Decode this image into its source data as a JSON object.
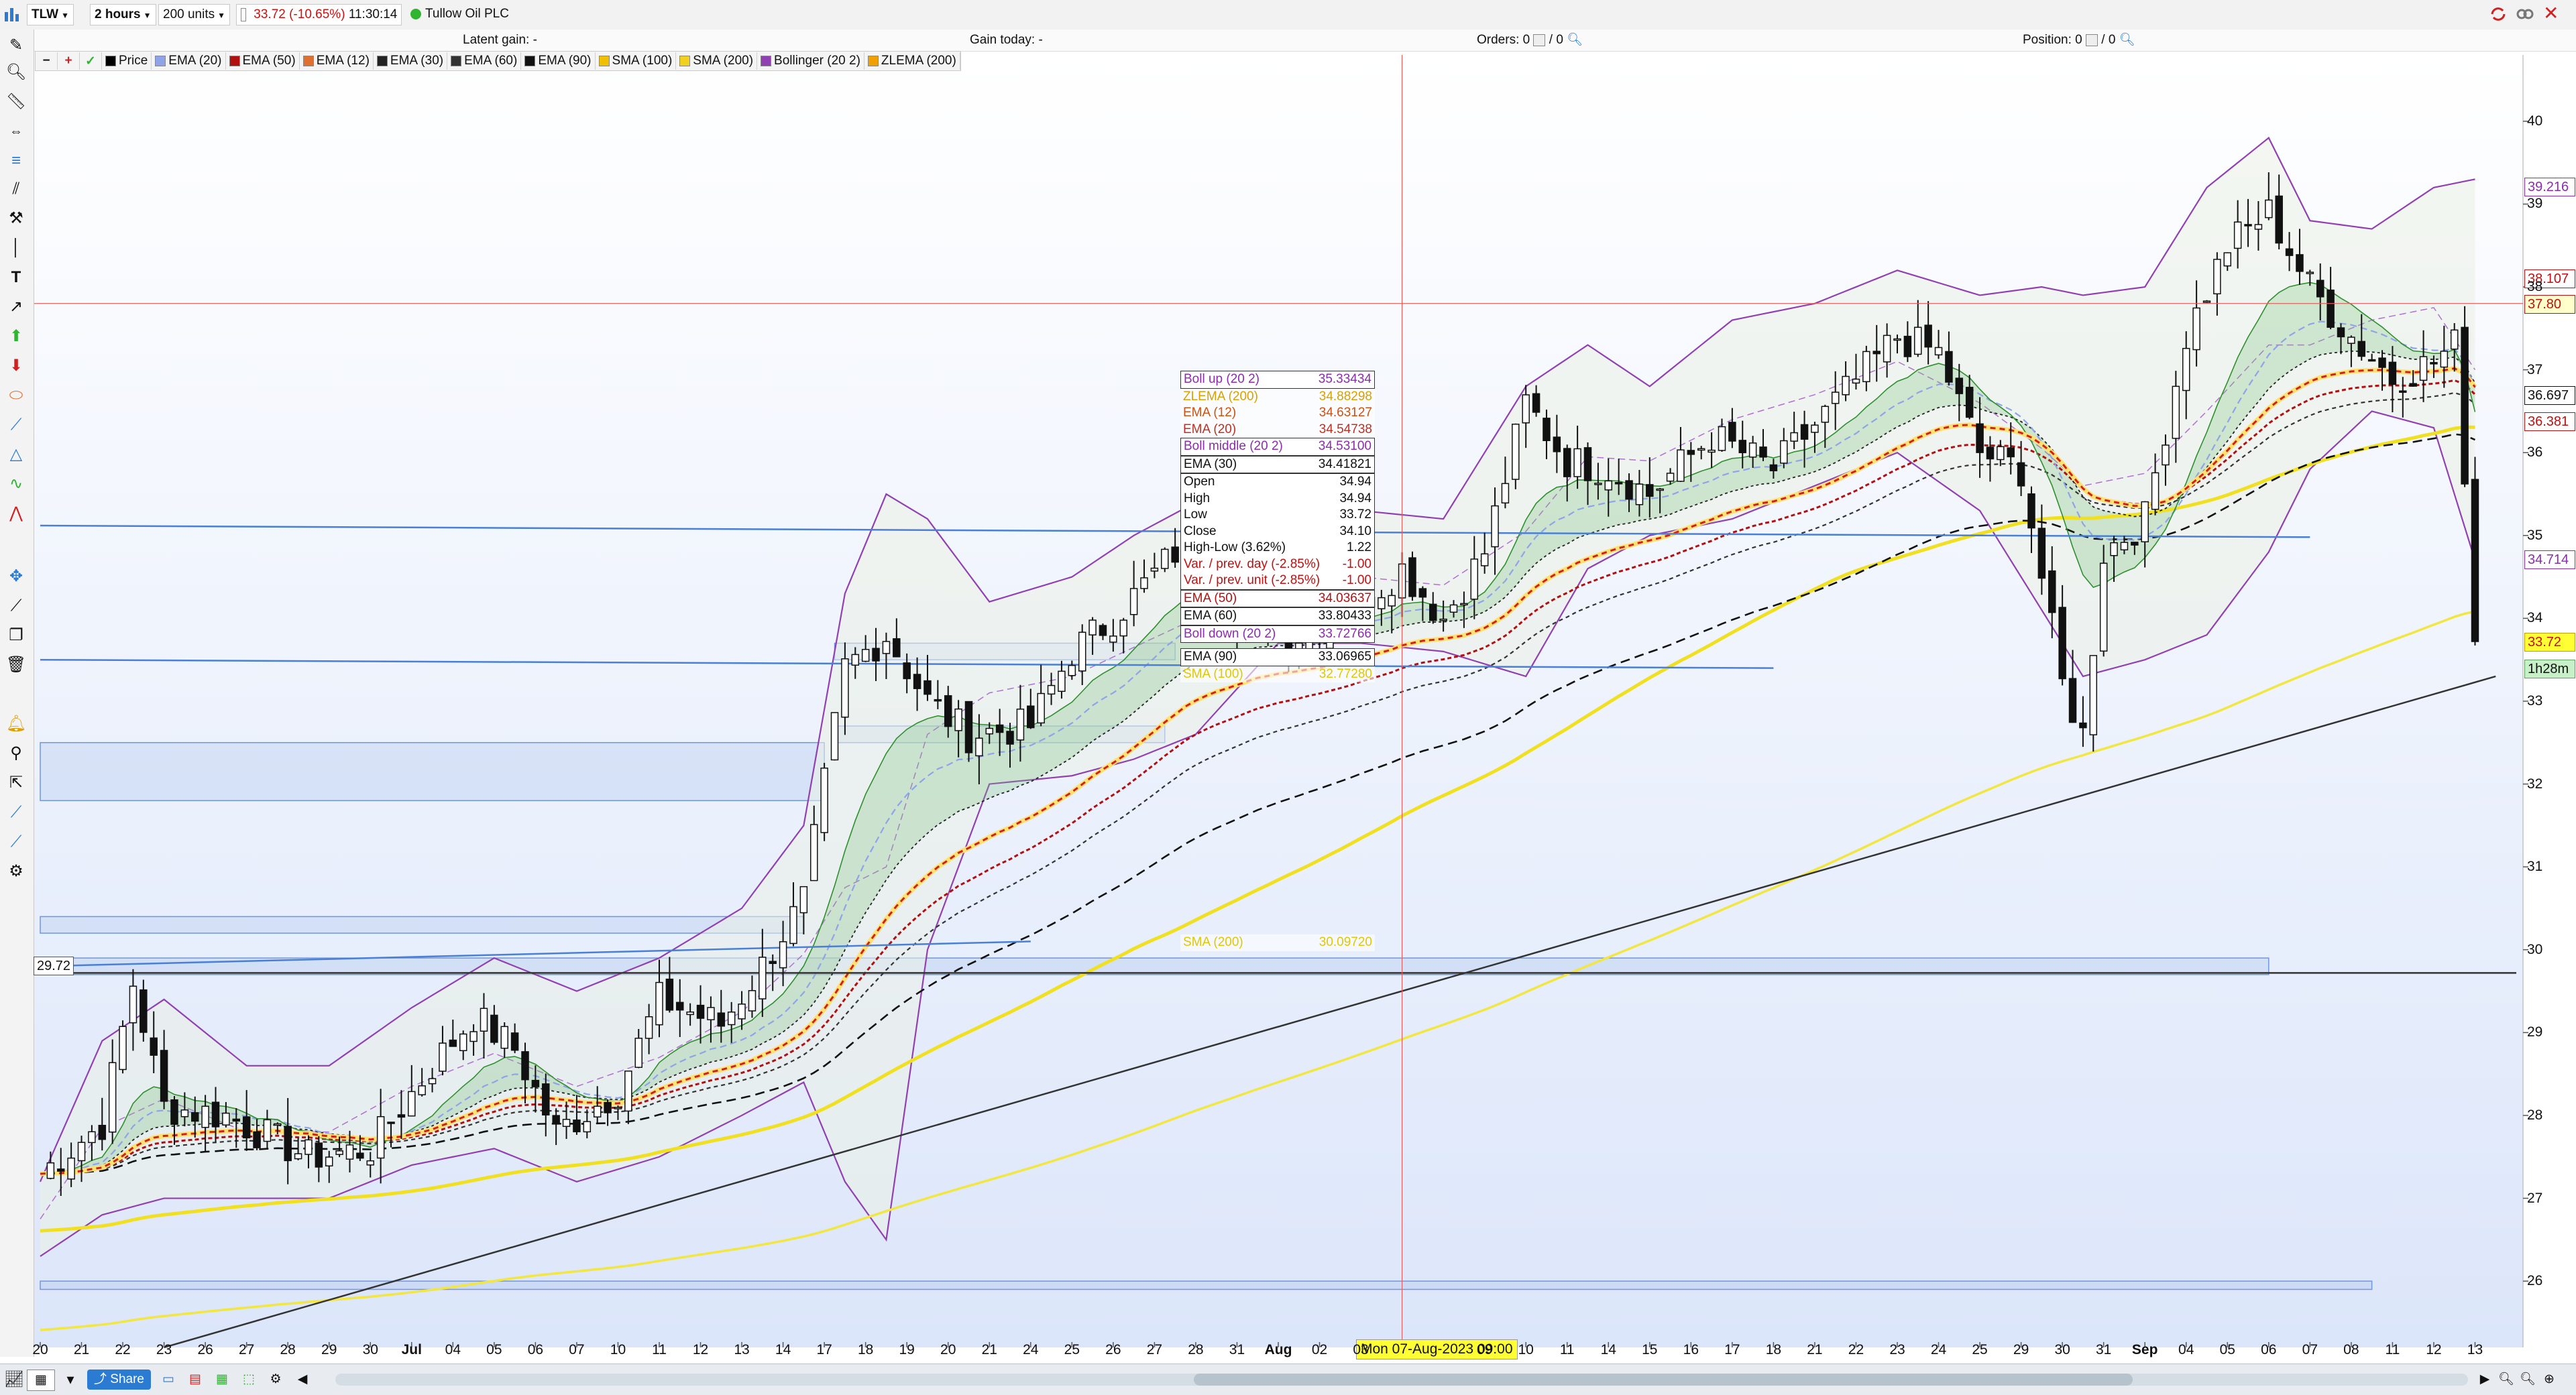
{
  "toolbar": {
    "symbol": "TLW",
    "interval": "2 hours",
    "units": "200 units",
    "last_price": "33.72",
    "change_pct": "(-10.65%)",
    "time": "11:30:14",
    "company": "Tullow Oil PLC"
  },
  "status": {
    "latent_gain": "Latent gain: -",
    "gain_today": "Gain today: -",
    "orders_label": "Orders: 0",
    "orders_count": "0",
    "position_label": "Position: 0",
    "position_count": "0"
  },
  "legend": {
    "items": [
      {
        "label": "Price",
        "color": "#000000"
      },
      {
        "label": "EMA (20)",
        "color": "#8fa3e8"
      },
      {
        "label": "EMA (50)",
        "color": "#b01010"
      },
      {
        "label": "EMA (12)",
        "color": "#e07030"
      },
      {
        "label": "EMA (30)",
        "color": "#222222"
      },
      {
        "label": "EMA (60)",
        "color": "#333333"
      },
      {
        "label": "EMA (90)",
        "color": "#111111"
      },
      {
        "label": "SMA (100)",
        "color": "#f0c000"
      },
      {
        "label": "SMA (200)",
        "color": "#f2d020"
      },
      {
        "label": "Bollinger (20 2)",
        "color": "#9040b0"
      },
      {
        "label": "ZLEMA (200)",
        "color": "#f0a000"
      }
    ]
  },
  "tooltip": {
    "rows_top": [
      {
        "label": "Boll up (20 2)",
        "value": "35.33434",
        "color": "#8b2bb0",
        "boxed": true
      },
      {
        "label": "ZLEMA (200)",
        "value": "34.88298",
        "color": "#d8a000",
        "boxed": false
      },
      {
        "label": "EMA (12)",
        "value": "34.63127",
        "color": "#d05010",
        "boxed": false
      },
      {
        "label": "EMA (20)",
        "value": "34.54738",
        "color": "#c03020",
        "boxed": false
      },
      {
        "label": "Boll middle (20 2)",
        "value": "34.53100",
        "color": "#8b2bb0",
        "boxed": true
      },
      {
        "label": "EMA (30)",
        "value": "34.41821",
        "color": "#111111",
        "boxed": true
      }
    ],
    "ohlc": [
      {
        "label": "Open",
        "value": "34.94"
      },
      {
        "label": "High",
        "value": "34.94"
      },
      {
        "label": "Low",
        "value": "33.72"
      },
      {
        "label": "Close",
        "value": "34.10"
      },
      {
        "label": "High-Low (3.62%)",
        "value": "1.22"
      }
    ],
    "var_rows": [
      {
        "label": "Var. / prev. day (-2.85%)",
        "value": "-1.00"
      },
      {
        "label": "Var. / prev. unit (-2.85%)",
        "value": "-1.00"
      }
    ],
    "rows_bottom": [
      {
        "label": "EMA (50)",
        "value": "34.03637",
        "color": "#b01010",
        "boxed": true
      },
      {
        "label": "EMA (60)",
        "value": "33.80433",
        "color": "#111111",
        "boxed": true
      },
      {
        "label": "Boll down (20 2)",
        "value": "33.72766",
        "color": "#8b2bb0",
        "boxed": true
      },
      {
        "label": "EMA (90)",
        "value": "33.06965",
        "color": "#111111",
        "boxed": true
      },
      {
        "label": "SMA (100)",
        "value": "32.77280",
        "color": "#e0c800",
        "boxed": false
      }
    ],
    "sma200": {
      "label": "SMA (200)",
      "value": "30.09720",
      "color": "#e0c800"
    }
  },
  "crosshair": {
    "datetime": "Mon 07-Aug-2023 09:00",
    "left_price": "29.72"
  },
  "price_labels": [
    {
      "value": "39.216",
      "price": 39.216,
      "bg": "#ffffff",
      "color": "#8b2bb0",
      "border": "#8b2bb0"
    },
    {
      "value": "38.107",
      "price": 38.107,
      "bg": "#ffffff",
      "color": "#c01010",
      "border": "#c01010"
    },
    {
      "value": "37.80",
      "price": 37.8,
      "bg": "#ffffcc",
      "color": "#c01010",
      "border": "#c01010"
    },
    {
      "value": "36.697",
      "price": 36.697,
      "bg": "#ffffff",
      "color": "#111111",
      "border": "#111111"
    },
    {
      "value": "36.381",
      "price": 36.381,
      "bg": "#ffffff",
      "color": "#c01010",
      "border": "#c01010"
    },
    {
      "value": "34.714",
      "price": 34.714,
      "bg": "#ffffff",
      "color": "#8b2bb0",
      "border": "#8b2bb0"
    },
    {
      "value": "33.72",
      "price": 33.72,
      "bg": "#ffff33",
      "color": "#c01010",
      "border": "#c0a000"
    },
    {
      "value": "1h28m",
      "price": 33.4,
      "bg": "#c8f0c8",
      "color": "#111111",
      "border": "#60a060"
    }
  ],
  "chart_data": {
    "type": "candlestick",
    "title": "TLW",
    "ylim": [
      25.2,
      40.8
    ],
    "yticks": [
      26,
      27,
      28,
      29,
      30,
      31,
      32,
      33,
      34,
      35,
      36,
      37,
      38,
      39,
      40
    ],
    "xticks": [
      {
        "label": "20",
        "i": 0
      },
      {
        "label": "21",
        "i": 4
      },
      {
        "label": "22",
        "i": 8
      },
      {
        "label": "23",
        "i": 12
      },
      {
        "label": "26",
        "i": 16
      },
      {
        "label": "27",
        "i": 20
      },
      {
        "label": "28",
        "i": 24
      },
      {
        "label": "29",
        "i": 28
      },
      {
        "label": "30",
        "i": 32
      },
      {
        "label": "Jul",
        "i": 36
      },
      {
        "label": "04",
        "i": 40
      },
      {
        "label": "05",
        "i": 44
      },
      {
        "label": "06",
        "i": 48
      },
      {
        "label": "07",
        "i": 52
      },
      {
        "label": "10",
        "i": 56
      },
      {
        "label": "11",
        "i": 60
      },
      {
        "label": "12",
        "i": 64
      },
      {
        "label": "13",
        "i": 68
      },
      {
        "label": "14",
        "i": 72
      },
      {
        "label": "17",
        "i": 76
      },
      {
        "label": "18",
        "i": 80
      },
      {
        "label": "19",
        "i": 84
      },
      {
        "label": "20",
        "i": 88
      },
      {
        "label": "21",
        "i": 92
      },
      {
        "label": "24",
        "i": 96
      },
      {
        "label": "25",
        "i": 100
      },
      {
        "label": "26",
        "i": 104
      },
      {
        "label": "27",
        "i": 108
      },
      {
        "label": "28",
        "i": 112
      },
      {
        "label": "31",
        "i": 116
      },
      {
        "label": "Aug",
        "i": 120
      },
      {
        "label": "02",
        "i": 124
      },
      {
        "label": "03",
        "i": 128
      },
      {
        "label": "09",
        "i": 140
      },
      {
        "label": "10",
        "i": 144
      },
      {
        "label": "11",
        "i": 148
      },
      {
        "label": "14",
        "i": 152
      },
      {
        "label": "15",
        "i": 156
      },
      {
        "label": "16",
        "i": 160
      },
      {
        "label": "17",
        "i": 164
      },
      {
        "label": "18",
        "i": 168
      },
      {
        "label": "21",
        "i": 172
      },
      {
        "label": "22",
        "i": 176
      },
      {
        "label": "23",
        "i": 180
      },
      {
        "label": "24",
        "i": 184
      },
      {
        "label": "25",
        "i": 188
      },
      {
        "label": "29",
        "i": 192
      },
      {
        "label": "30",
        "i": 196
      },
      {
        "label": "31",
        "i": 200
      },
      {
        "label": "Sep",
        "i": 204
      },
      {
        "label": "04",
        "i": 208
      },
      {
        "label": "05",
        "i": 212
      },
      {
        "label": "06",
        "i": 216
      },
      {
        "label": "07",
        "i": 220
      },
      {
        "label": "08",
        "i": 224
      },
      {
        "label": "11",
        "i": 228
      },
      {
        "label": "12",
        "i": 232
      },
      {
        "label": "13",
        "i": 236
      }
    ],
    "close_anchors": [
      [
        0,
        27.3
      ],
      [
        6,
        27.9
      ],
      [
        9,
        29.6
      ],
      [
        12,
        28.1
      ],
      [
        18,
        28.0
      ],
      [
        26,
        27.5
      ],
      [
        32,
        27.6
      ],
      [
        38,
        28.6
      ],
      [
        42,
        29.2
      ],
      [
        46,
        28.8
      ],
      [
        50,
        27.8
      ],
      [
        56,
        28.3
      ],
      [
        60,
        29.4
      ],
      [
        66,
        29.1
      ],
      [
        70,
        29.8
      ],
      [
        74,
        30.6
      ],
      [
        78,
        33.4
      ],
      [
        82,
        33.8
      ],
      [
        86,
        33.0
      ],
      [
        90,
        32.6
      ],
      [
        96,
        32.7
      ],
      [
        100,
        33.6
      ],
      [
        104,
        34.0
      ],
      [
        110,
        34.8
      ],
      [
        116,
        34.0
      ],
      [
        122,
        33.8
      ],
      [
        128,
        34.2
      ],
      [
        132,
        34.6
      ],
      [
        136,
        34.0
      ],
      [
        140,
        34.8
      ],
      [
        144,
        36.6
      ],
      [
        148,
        35.9
      ],
      [
        152,
        35.8
      ],
      [
        156,
        35.5
      ],
      [
        162,
        36.2
      ],
      [
        168,
        35.8
      ],
      [
        174,
        36.6
      ],
      [
        180,
        37.4
      ],
      [
        184,
        37.2
      ],
      [
        188,
        36.0
      ],
      [
        192,
        35.8
      ],
      [
        196,
        33.2
      ],
      [
        198,
        32.6
      ],
      [
        200,
        34.8
      ],
      [
        204,
        35.2
      ],
      [
        208,
        37.4
      ],
      [
        212,
        38.5
      ],
      [
        216,
        38.9
      ],
      [
        220,
        38.0
      ],
      [
        224,
        37.4
      ],
      [
        228,
        36.9
      ],
      [
        232,
        37.1
      ],
      [
        234,
        37.3
      ],
      [
        235,
        35.8
      ],
      [
        236,
        33.72
      ]
    ],
    "bollinger_anchors": [
      [
        0,
        27.2,
        26.3
      ],
      [
        6,
        28.9,
        26.8
      ],
      [
        12,
        29.4,
        27.0
      ],
      [
        20,
        28.6,
        27.0
      ],
      [
        28,
        28.6,
        27.0
      ],
      [
        36,
        29.3,
        27.4
      ],
      [
        44,
        29.9,
        27.6
      ],
      [
        52,
        29.5,
        27.2
      ],
      [
        60,
        29.9,
        27.5
      ],
      [
        68,
        30.5,
        28.0
      ],
      [
        74,
        31.5,
        28.4
      ],
      [
        78,
        34.3,
        27.2
      ],
      [
        82,
        35.5,
        26.5
      ],
      [
        86,
        35.2,
        30.0
      ],
      [
        92,
        34.2,
        32.0
      ],
      [
        100,
        34.5,
        32.1
      ],
      [
        106,
        35.0,
        32.3
      ],
      [
        112,
        35.4,
        32.6
      ],
      [
        120,
        35.3,
        33.7
      ],
      [
        128,
        35.3,
        33.7
      ],
      [
        136,
        35.2,
        33.6
      ],
      [
        144,
        36.8,
        33.3
      ],
      [
        150,
        37.3,
        34.6
      ],
      [
        156,
        36.8,
        35.0
      ],
      [
        164,
        37.6,
        35.2
      ],
      [
        172,
        37.8,
        35.6
      ],
      [
        180,
        38.2,
        36.0
      ],
      [
        188,
        37.9,
        35.3
      ],
      [
        194,
        38.0,
        34.1
      ],
      [
        198,
        37.9,
        33.3
      ],
      [
        204,
        38.0,
        33.5
      ],
      [
        210,
        39.2,
        33.8
      ],
      [
        216,
        39.8,
        34.8
      ],
      [
        220,
        38.8,
        35.8
      ],
      [
        226,
        38.7,
        36.5
      ],
      [
        232,
        39.2,
        36.3
      ],
      [
        236,
        39.3,
        34.7
      ]
    ],
    "h_lines": [
      {
        "name": "resistance-line-upper",
        "from_i": 0,
        "to_i": 220,
        "from_y": 35.12,
        "to_y": 34.98,
        "color": "#4a7fd6"
      },
      {
        "name": "resistance-line-lower",
        "from_i": 0,
        "to_i": 168,
        "from_y": 33.5,
        "to_y": 33.4,
        "color": "#4a7fd6"
      },
      {
        "name": "support-line",
        "from_i": 0,
        "to_i": 96,
        "from_y": 29.8,
        "to_y": 30.1,
        "color": "#4a7fd6"
      },
      {
        "name": "trend-line",
        "from_i": 12,
        "to_i": 238,
        "from_y": 25.2,
        "to_y": 33.3,
        "color": "#333333"
      },
      {
        "name": "horizontal-price-line",
        "from_i": 0,
        "to_i": 240,
        "from_y": 29.72,
        "to_y": 29.72,
        "color": "#333333"
      }
    ],
    "zones": [
      {
        "name": "zone-1",
        "from_i": 0,
        "to_i": 76,
        "y0": 31.8,
        "y1": 32.5
      },
      {
        "name": "zone-2",
        "from_i": 0,
        "to_i": 74,
        "y0": 30.2,
        "y1": 30.4
      },
      {
        "name": "zone-3",
        "from_i": 0,
        "to_i": 216,
        "y0": 29.7,
        "y1": 29.9
      },
      {
        "name": "zone-4",
        "from_i": 77,
        "to_i": 109,
        "y0": 32.5,
        "y1": 32.7
      },
      {
        "name": "zone-5",
        "from_i": 77,
        "to_i": 110,
        "y0": 33.5,
        "y1": 33.7
      },
      {
        "name": "zone-6",
        "from_i": 0,
        "to_i": 226,
        "y0": 25.9,
        "y1": 26.0
      }
    ]
  }
}
